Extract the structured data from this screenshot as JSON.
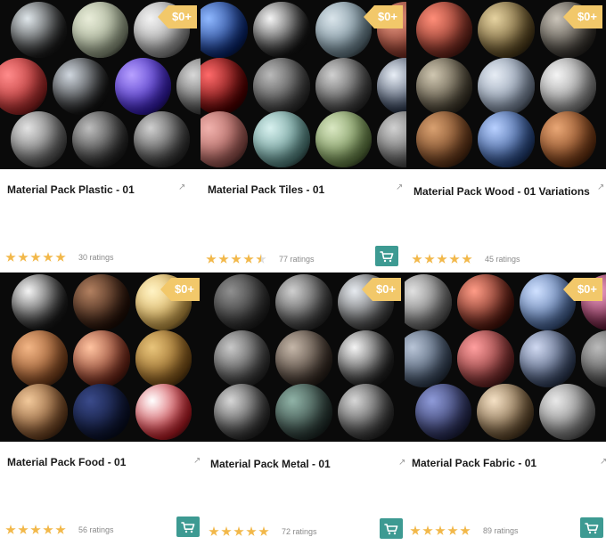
{
  "cards": [
    {
      "title": "Material Pack Plastic - 01",
      "price": "$0+",
      "rating": 5,
      "ratings_text": "30 ratings",
      "show_cart": false,
      "spheres": [
        {
          "c1": "#dfe6ea",
          "c2": "#222"
        },
        {
          "c1": "#e8ecd8",
          "c2": "#9aa58a"
        },
        {
          "c1": "#f2f2f2",
          "c2": "#9a9a9a"
        },
        {
          "c1": "#ff8a8a",
          "c2": "#b02a2a"
        },
        {
          "c1": "#cfd6de",
          "c2": "#1a1a1a"
        },
        {
          "c1": "#b7a0ff",
          "c2": "#3a1fc0"
        },
        {
          "c1": "#d8d8d8",
          "c2": "#4a4a4a"
        },
        {
          "c1": "#e2e2e2",
          "c2": "#606060"
        },
        {
          "c1": "#bdbdbd",
          "c2": "#2c2c2c"
        },
        {
          "c1": "#cfcfcf",
          "c2": "#3a3a3a"
        }
      ]
    },
    {
      "title": "Material Pack Tiles - 01",
      "price": "$0+",
      "rating": 4.5,
      "ratings_text": "77 ratings",
      "show_cart": true,
      "spheres": [
        {
          "c1": "#8fb8ff",
          "c2": "#0b2b7a"
        },
        {
          "c1": "#f4f4f4",
          "c2": "#1b1b1b"
        },
        {
          "c1": "#d9e4ea",
          "c2": "#6e8794"
        },
        {
          "c1": "#e79a84",
          "c2": "#8a3528"
        },
        {
          "c1": "#ff6a6a",
          "c2": "#5c0000"
        },
        {
          "c1": "#b9b9b9",
          "c2": "#3a3a3a"
        },
        {
          "c1": "#d0d0d0",
          "c2": "#404040"
        },
        {
          "c1": "#e8eef6",
          "c2": "#25324a"
        },
        {
          "c1": "#f0b1ac",
          "c2": "#a55a55"
        },
        {
          "c1": "#d7f0ee",
          "c2": "#5a8f8b"
        },
        {
          "c1": "#d9e7c2",
          "c2": "#6c8a4a"
        },
        {
          "c1": "#d0d0d0",
          "c2": "#555"
        }
      ]
    },
    {
      "title": "Material Pack Wood - 01 Variations",
      "price": "$0+",
      "rating": 5,
      "ratings_text": "45 ratings",
      "show_cart": false,
      "spheres": [
        {
          "c1": "#ff8d78",
          "c2": "#7a2a1f"
        },
        {
          "c1": "#e5d2a0",
          "c2": "#5e4a22"
        },
        {
          "c1": "#c9c3b8",
          "c2": "#3c3832"
        },
        {
          "c1": "#cfc6b0",
          "c2": "#463f30"
        },
        {
          "c1": "#e6ecf4",
          "c2": "#7f8ea4"
        },
        {
          "c1": "#f4f4f4",
          "c2": "#8a8a8a"
        },
        {
          "c1": "#d8a070",
          "c2": "#6a3a1a"
        },
        {
          "c1": "#b8d0ff",
          "c2": "#2a4c8a"
        },
        {
          "c1": "#e8a675",
          "c2": "#7a3c16"
        }
      ]
    },
    {
      "title": "Material Pack Food - 01",
      "price": "$0+",
      "rating": 5,
      "ratings_text": "56 ratings",
      "show_cart": true,
      "spheres": [
        {
          "c1": "#f4f4f4",
          "c2": "#222"
        },
        {
          "c1": "#b28060",
          "c2": "#2a140a"
        },
        {
          "c1": "#fff3c4",
          "c2": "#d6a74a"
        },
        {
          "c1": "#f2b585",
          "c2": "#8a4a20"
        },
        {
          "c1": "#ffc3a0",
          "c2": "#7a2a1a"
        },
        {
          "c1": "#e8c47a",
          "c2": "#8a5a1a"
        },
        {
          "c1": "#f1c89a",
          "c2": "#7a4a25"
        },
        {
          "c1": "#3a4a8a",
          "c2": "#0c1430"
        },
        {
          "c1": "#ffffff",
          "c2": "#d0202a"
        }
      ]
    },
    {
      "title": "Material Pack Metal - 01",
      "price": "$0+",
      "rating": 5,
      "ratings_text": "72 ratings",
      "show_cart": true,
      "spheres": [
        {
          "c1": "#8f8f8f",
          "c2": "#2a2a2a"
        },
        {
          "c1": "#cfcfcf",
          "c2": "#3a3a3a"
        },
        {
          "c1": "#e6eaef",
          "c2": "#4a4a4a"
        },
        {
          "c1": "#c8c8c8",
          "c2": "#3a3a3a"
        },
        {
          "c1": "#c4b6a8",
          "c2": "#3a2e26"
        },
        {
          "c1": "#f4f4f4",
          "c2": "#2a2a2a"
        },
        {
          "c1": "#d6d6d6",
          "c2": "#353535"
        },
        {
          "c1": "#8fb2a6",
          "c2": "#2a3a36"
        },
        {
          "c1": "#d6d6d6",
          "c2": "#3a3a3a"
        }
      ]
    },
    {
      "title": "Material Pack Fabric - 01",
      "price": "$0+",
      "rating": 5,
      "ratings_text": "89 ratings",
      "show_cart": true,
      "spheres": [
        {
          "c1": "#e0e0e0",
          "c2": "#6a6a6a"
        },
        {
          "c1": "#ff9b86",
          "c2": "#5a1a10"
        },
        {
          "c1": "#cfe0ff",
          "c2": "#4a6aa0"
        },
        {
          "c1": "#f0a0c8",
          "c2": "#6a1a3a"
        },
        {
          "c1": "#b8c4d6",
          "c2": "#3a4a60"
        },
        {
          "c1": "#ff9e9e",
          "c2": "#7a2a2a"
        },
        {
          "c1": "#cfd8f0",
          "c2": "#3a4a6a"
        },
        {
          "c1": "#bababa",
          "c2": "#4a4a4a"
        },
        {
          "c1": "#8e9ad8",
          "c2": "#2a2f5a"
        },
        {
          "c1": "#f4e0c4",
          "c2": "#6a5030"
        },
        {
          "c1": "#e8e8e8",
          "c2": "#7a7a7a"
        }
      ]
    }
  ]
}
